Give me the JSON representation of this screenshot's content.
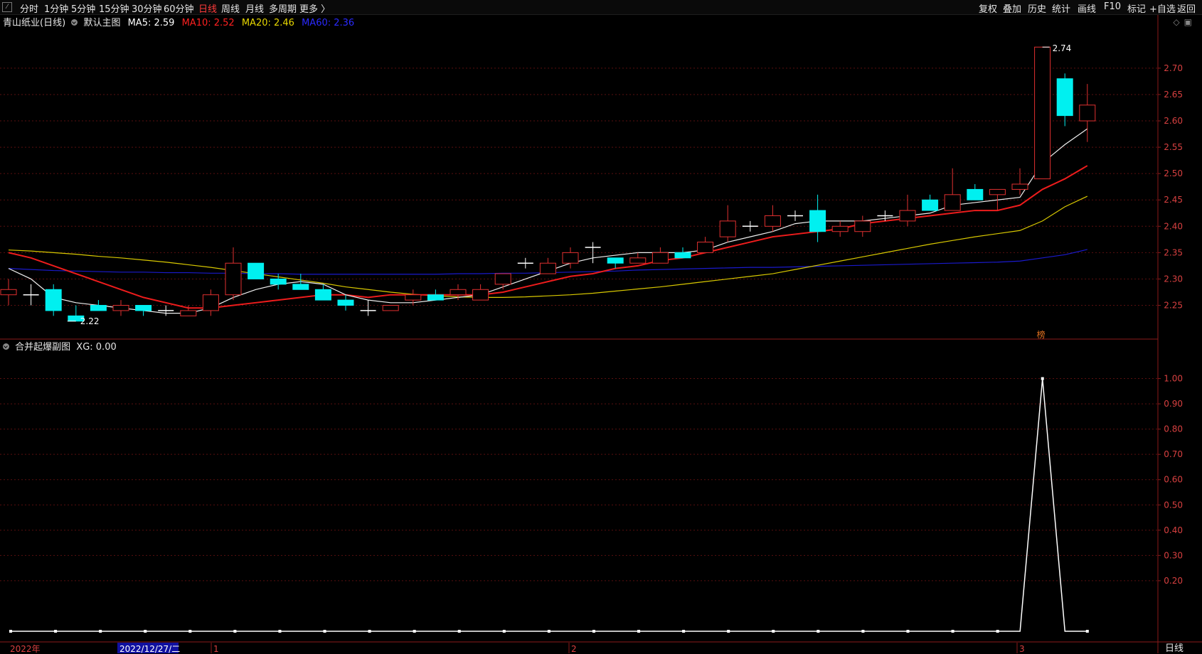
{
  "toolbar": {
    "left_items": [
      "分时",
      "1分钟",
      "5分钟",
      "15分钟",
      "30分钟",
      "60分钟",
      "日线",
      "周线",
      "月线",
      "多周期",
      "更多 〉"
    ],
    "active": "日线",
    "right_items": [
      "复权",
      "叠加",
      "历史",
      "统计",
      "画线",
      "F10",
      "标记",
      "+自选",
      "返回"
    ]
  },
  "main_info": {
    "stock": "青山纸业(日线)",
    "template": "默认主图",
    "ma5": "MA5: 2.59",
    "ma10": "MA10: 2.52",
    "ma20": "MA20: 2.46",
    "ma60": "MA60: 2.36",
    "colors": {
      "ma5": "#ffffff",
      "ma10": "#ff2020",
      "ma20": "#e0d000",
      "ma60": "#2020ff",
      "up": "#e03030",
      "down": "#00f0f0"
    }
  },
  "sub_info": {
    "title": "合并起爆副图",
    "xg": "XG: 0.00"
  },
  "price_axis": [
    "2.70",
    "2.65",
    "2.60",
    "2.55",
    "2.50",
    "2.45",
    "2.40",
    "2.35",
    "2.30",
    "2.25"
  ],
  "sub_axis": [
    "1.00",
    "0.90",
    "0.80",
    "0.70",
    "0.60",
    "0.50",
    "0.40",
    "0.30",
    "0.20"
  ],
  "annotations": {
    "high": "2.74",
    "low": "2.22",
    "badge": "榜"
  },
  "date_axis": {
    "year": "2022年",
    "cursor": "2022/12/27/二",
    "m1": "1",
    "m2": "2",
    "m3": "3"
  },
  "period_label": "日线",
  "chart_data": {
    "type": "candlestick",
    "ylim": [
      2.19,
      2.77
    ],
    "candles": [
      [
        2.27,
        2.28,
        2.25,
        2.3
      ],
      [
        2.27,
        2.27,
        2.25,
        2.29
      ],
      [
        2.28,
        2.24,
        2.23,
        2.29
      ],
      [
        2.23,
        2.22,
        2.22,
        2.25
      ],
      [
        2.25,
        2.24,
        2.24,
        2.26
      ],
      [
        2.24,
        2.25,
        2.23,
        2.26
      ],
      [
        2.25,
        2.24,
        2.23,
        2.25
      ],
      [
        2.24,
        2.24,
        2.23,
        2.25
      ],
      [
        2.23,
        2.24,
        2.23,
        2.25
      ],
      [
        2.24,
        2.27,
        2.23,
        2.28
      ],
      [
        2.27,
        2.33,
        2.26,
        2.36
      ],
      [
        2.33,
        2.3,
        2.3,
        2.33
      ],
      [
        2.3,
        2.29,
        2.28,
        2.31
      ],
      [
        2.29,
        2.28,
        2.28,
        2.31
      ],
      [
        2.28,
        2.26,
        2.26,
        2.29
      ],
      [
        2.26,
        2.25,
        2.24,
        2.27
      ],
      [
        2.24,
        2.24,
        2.23,
        2.26
      ],
      [
        2.24,
        2.25,
        2.24,
        2.25
      ],
      [
        2.26,
        2.27,
        2.25,
        2.28
      ],
      [
        2.27,
        2.26,
        2.26,
        2.28
      ],
      [
        2.27,
        2.28,
        2.26,
        2.29
      ],
      [
        2.26,
        2.28,
        2.26,
        2.29
      ],
      [
        2.29,
        2.31,
        2.28,
        2.31
      ],
      [
        2.33,
        2.33,
        2.32,
        2.34
      ],
      [
        2.31,
        2.33,
        2.31,
        2.34
      ],
      [
        2.33,
        2.35,
        2.32,
        2.36
      ],
      [
        2.36,
        2.36,
        2.33,
        2.37
      ],
      [
        2.34,
        2.33,
        2.32,
        2.34
      ],
      [
        2.33,
        2.34,
        2.33,
        2.35
      ],
      [
        2.33,
        2.35,
        2.33,
        2.36
      ],
      [
        2.35,
        2.34,
        2.34,
        2.36
      ],
      [
        2.35,
        2.37,
        2.35,
        2.38
      ],
      [
        2.38,
        2.41,
        2.37,
        2.44
      ],
      [
        2.4,
        2.4,
        2.39,
        2.41
      ],
      [
        2.4,
        2.42,
        2.39,
        2.44
      ],
      [
        2.42,
        2.42,
        2.41,
        2.43
      ],
      [
        2.43,
        2.39,
        2.37,
        2.46
      ],
      [
        2.39,
        2.4,
        2.38,
        2.41
      ],
      [
        2.39,
        2.41,
        2.38,
        2.42
      ],
      [
        2.42,
        2.42,
        2.41,
        2.43
      ],
      [
        2.41,
        2.43,
        2.4,
        2.46
      ],
      [
        2.45,
        2.43,
        2.43,
        2.46
      ],
      [
        2.43,
        2.46,
        2.43,
        2.51
      ],
      [
        2.47,
        2.45,
        2.45,
        2.48
      ],
      [
        2.46,
        2.47,
        2.43,
        2.47
      ],
      [
        2.47,
        2.48,
        2.46,
        2.51
      ],
      [
        2.49,
        2.74,
        2.49,
        2.74
      ],
      [
        2.68,
        2.61,
        2.59,
        2.69
      ],
      [
        2.6,
        2.63,
        2.56,
        2.67
      ]
    ],
    "ma5": [
      2.32,
      2.3,
      2.265,
      2.255,
      2.25,
      2.245,
      2.24,
      2.235,
      2.235,
      2.245,
      2.265,
      2.28,
      2.29,
      2.295,
      2.29,
      2.27,
      2.26,
      2.255,
      2.255,
      2.26,
      2.265,
      2.27,
      2.285,
      2.3,
      2.315,
      2.33,
      2.34,
      2.345,
      2.35,
      2.35,
      2.35,
      2.355,
      2.37,
      2.38,
      2.39,
      2.405,
      2.41,
      2.41,
      2.41,
      2.415,
      2.42,
      2.425,
      2.44,
      2.445,
      2.45,
      2.455,
      2.52,
      2.555,
      2.585
    ],
    "ma10": [
      2.35,
      2.34,
      2.325,
      2.31,
      2.295,
      2.28,
      2.265,
      2.255,
      2.245,
      2.245,
      2.25,
      2.255,
      2.26,
      2.265,
      2.27,
      2.27,
      2.265,
      2.27,
      2.27,
      2.27,
      2.27,
      2.27,
      2.275,
      2.285,
      2.295,
      2.305,
      2.31,
      2.32,
      2.325,
      2.335,
      2.34,
      2.35,
      2.36,
      2.37,
      2.38,
      2.385,
      2.39,
      2.395,
      2.405,
      2.41,
      2.415,
      2.42,
      2.425,
      2.43,
      2.43,
      2.44,
      2.47,
      2.49,
      2.515
    ],
    "ma20": [
      2.355,
      2.353,
      2.35,
      2.347,
      2.343,
      2.34,
      2.336,
      2.332,
      2.327,
      2.322,
      2.316,
      2.31,
      2.304,
      2.298,
      2.292,
      2.285,
      2.28,
      2.275,
      2.271,
      2.268,
      2.266,
      2.265,
      2.265,
      2.266,
      2.268,
      2.27,
      2.273,
      2.277,
      2.281,
      2.285,
      2.29,
      2.295,
      2.3,
      2.305,
      2.31,
      2.318,
      2.326,
      2.334,
      2.342,
      2.35,
      2.358,
      2.366,
      2.373,
      2.38,
      2.386,
      2.392,
      2.41,
      2.437,
      2.457
    ],
    "ma60": [
      2.32,
      2.318,
      2.316,
      2.315,
      2.314,
      2.313,
      2.313,
      2.312,
      2.312,
      2.311,
      2.311,
      2.31,
      2.31,
      2.309,
      2.309,
      2.309,
      2.309,
      2.309,
      2.309,
      2.309,
      2.31,
      2.31,
      2.311,
      2.311,
      2.312,
      2.313,
      2.314,
      2.315,
      2.317,
      2.318,
      2.319,
      2.32,
      2.321,
      2.322,
      2.322,
      2.323,
      2.324,
      2.325,
      2.326,
      2.327,
      2.328,
      2.329,
      2.33,
      2.331,
      2.332,
      2.334,
      2.34,
      2.346,
      2.356
    ],
    "xg": [
      0,
      0,
      0,
      0,
      0,
      0,
      0,
      0,
      0,
      0,
      0,
      0,
      0,
      0,
      0,
      0,
      0,
      0,
      0,
      0,
      0,
      0,
      0,
      0,
      0,
      0,
      0,
      0,
      0,
      0,
      0,
      0,
      0,
      0,
      0,
      0,
      0,
      0,
      0,
      0,
      0,
      0,
      0,
      0,
      0,
      0,
      1,
      0,
      0
    ],
    "sub_ylim": [
      0,
      1.1
    ]
  }
}
